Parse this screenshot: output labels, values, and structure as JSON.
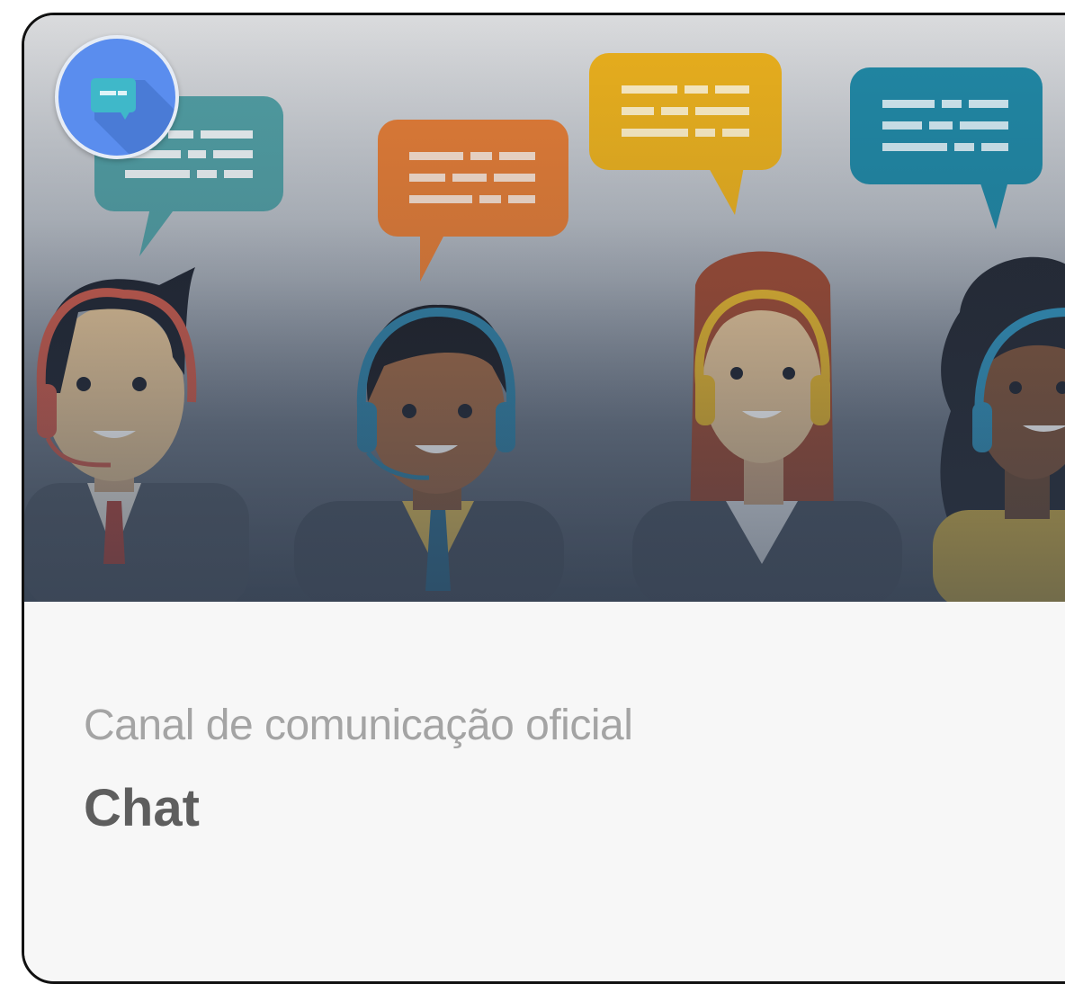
{
  "card": {
    "subtitle": "Canal de comunicação oficial",
    "title": "Chat",
    "icon": "chat-bubble-icon",
    "banner_image": "support-agents-with-headsets-illustration"
  },
  "colors": {
    "badge": "#5a8dee",
    "badge_bubble": "#3fb8c9",
    "bubble_teal": "#4f9ba0",
    "bubble_orange": "#e07a34",
    "bubble_yellow": "#e8ae1c",
    "bubble_blue": "#1f86a3",
    "subtitle_text": "#a4a4a4",
    "title_text": "#5e5e5e"
  }
}
